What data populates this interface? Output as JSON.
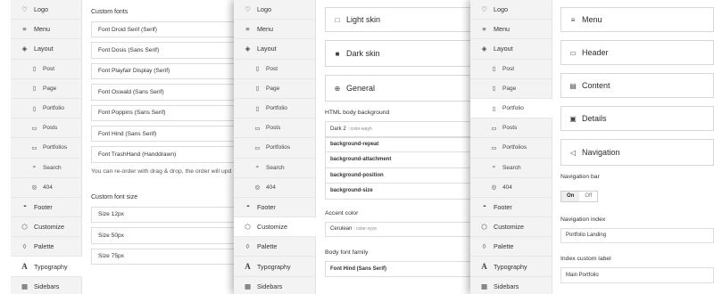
{
  "sidebar1": [
    {
      "label": "Logo",
      "icon": "heart-icon",
      "sub": false
    },
    {
      "label": "Menu",
      "icon": "menu-icon",
      "sub": false
    },
    {
      "label": "Layout",
      "icon": "layers-icon",
      "sub": false
    },
    {
      "label": "Post",
      "icon": "page-icon",
      "sub": true
    },
    {
      "label": "Page",
      "icon": "page-icon",
      "sub": true
    },
    {
      "label": "Portfolio",
      "icon": "page-icon",
      "sub": true
    },
    {
      "label": "Posts",
      "icon": "posts-icon",
      "sub": true
    },
    {
      "label": "Portfolios",
      "icon": "posts-icon",
      "sub": true
    },
    {
      "label": "Search",
      "icon": "search-icon",
      "sub": true
    },
    {
      "label": "404",
      "icon": "target-icon",
      "sub": true
    },
    {
      "label": "Footer",
      "icon": "dots-icon",
      "sub": false
    },
    {
      "label": "Customize",
      "icon": "cube-icon",
      "sub": false
    },
    {
      "label": "Palette",
      "icon": "drop-icon",
      "sub": false
    },
    {
      "label": "Typography",
      "icon": "type-icon",
      "sub": false,
      "active": true
    },
    {
      "label": "Sidebars",
      "icon": "grid-icon",
      "sub": false
    }
  ],
  "sidebar2": [
    {
      "label": "Logo",
      "icon": "heart-icon",
      "sub": false
    },
    {
      "label": "Menu",
      "icon": "menu-icon",
      "sub": false
    },
    {
      "label": "Layout",
      "icon": "layers-icon",
      "sub": false
    },
    {
      "label": "Post",
      "icon": "page-icon",
      "sub": true
    },
    {
      "label": "Page",
      "icon": "page-icon",
      "sub": true
    },
    {
      "label": "Portfolio",
      "icon": "page-icon",
      "sub": true
    },
    {
      "label": "Posts",
      "icon": "posts-icon",
      "sub": true
    },
    {
      "label": "Portfolios",
      "icon": "posts-icon",
      "sub": true
    },
    {
      "label": "Search",
      "icon": "search-icon",
      "sub": true
    },
    {
      "label": "404",
      "icon": "target-icon",
      "sub": true
    },
    {
      "label": "Footer",
      "icon": "dots-icon",
      "sub": false
    },
    {
      "label": "Customize",
      "icon": "cube-icon",
      "sub": false,
      "active": true
    },
    {
      "label": "Palette",
      "icon": "drop-icon",
      "sub": false
    },
    {
      "label": "Typography",
      "icon": "type-icon",
      "sub": false
    },
    {
      "label": "Sidebars",
      "icon": "grid-icon",
      "sub": false
    }
  ],
  "sidebar3": [
    {
      "label": "Logo",
      "icon": "heart-icon",
      "sub": false
    },
    {
      "label": "Menu",
      "icon": "menu-icon",
      "sub": false
    },
    {
      "label": "Layout",
      "icon": "layers-icon",
      "sub": false
    },
    {
      "label": "Post",
      "icon": "page-icon",
      "sub": true
    },
    {
      "label": "Page",
      "icon": "page-icon",
      "sub": true
    },
    {
      "label": "Portfolio",
      "icon": "page-icon",
      "sub": true,
      "active": true
    },
    {
      "label": "Posts",
      "icon": "posts-icon",
      "sub": true
    },
    {
      "label": "Portfolios",
      "icon": "posts-icon",
      "sub": true
    },
    {
      "label": "Search",
      "icon": "search-icon",
      "sub": true
    },
    {
      "label": "404",
      "icon": "target-icon",
      "sub": true
    },
    {
      "label": "Footer",
      "icon": "dots-icon",
      "sub": false
    },
    {
      "label": "Customize",
      "icon": "cube-icon",
      "sub": false
    },
    {
      "label": "Palette",
      "icon": "drop-icon",
      "sub": false
    },
    {
      "label": "Typography",
      "icon": "type-icon",
      "sub": false
    },
    {
      "label": "Sidebars",
      "icon": "grid-icon",
      "sub": false
    }
  ],
  "typography": {
    "custom_fonts_title": "Custom fonts",
    "fonts": [
      "Font Droid Serif (Serif)",
      "Font Dosis (Sans Serif)",
      "Font Playfair Display (Serif)",
      "Font Oswald (Sans Serif)",
      "Font Poppins (Sans Serif)",
      "Font Hind (Sans Serif)",
      "Font TrashHand (Handdrawn)"
    ],
    "reorder_hint": "You can re-order with drag & drop, the order will upd",
    "font_size_title": "Custom font size",
    "sizes": [
      "Size 12px",
      "Size 50px",
      "Size 75px"
    ]
  },
  "customize": {
    "light_skin": "Light skin",
    "dark_skin": "Dark skin",
    "general": "General",
    "html_bg_label": "HTML body background",
    "bg_value": "Dark 2",
    "bg_value_small": ": color-wayh",
    "bg_props": [
      "background-repeat",
      "background-attachment",
      "background-position",
      "background-size"
    ],
    "accent_label": "Accent color",
    "accent_value": "Cerulean",
    "accent_small": ": color-vyce",
    "body_font_label": "Body font family",
    "body_font_value": "Font Hind (Sans Serif)"
  },
  "portfolio": {
    "panels": [
      {
        "label": "Menu",
        "icon": "menu-icon"
      },
      {
        "label": "Header",
        "icon": "header-icon"
      },
      {
        "label": "Content",
        "icon": "content-icon"
      },
      {
        "label": "Details",
        "icon": "briefcase-icon"
      },
      {
        "label": "Navigation",
        "icon": "navigation-icon"
      }
    ],
    "nav_bar_label": "Navigation bar",
    "toggle_on": "On",
    "toggle_off": "Off",
    "nav_index_label": "Navigation index",
    "nav_index_value": "Portfolio Landing",
    "index_custom_label": "Index custom label",
    "index_custom_value": "Main Portfolio"
  },
  "colors": {
    "accent_blue": "#2d8ad0",
    "swatch_dark": "#111111"
  }
}
